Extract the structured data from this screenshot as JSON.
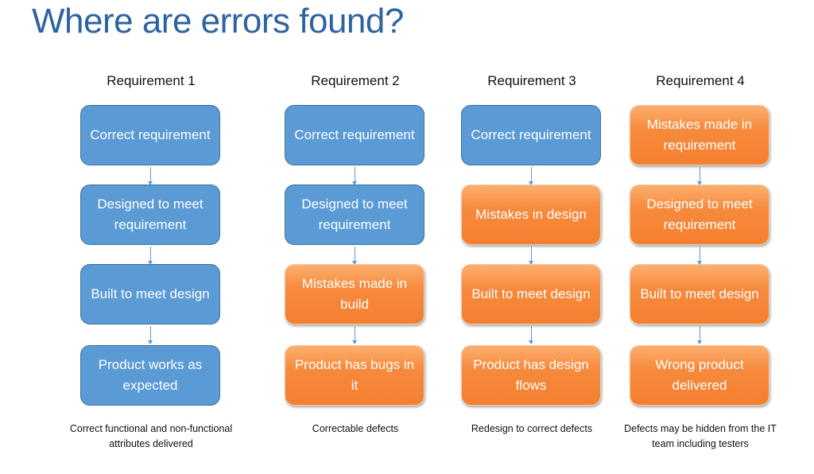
{
  "title": "Where are errors found?",
  "colors": {
    "correct": "#5b9bd5",
    "mistake": "#f68a3d",
    "title": "#2e63a2"
  },
  "columns": [
    {
      "heading": "Requirement 1",
      "steps": [
        {
          "text": "Correct requirement",
          "status": "correct"
        },
        {
          "text": "Designed to meet requirement",
          "status": "correct"
        },
        {
          "text": "Built to meet design",
          "status": "correct"
        },
        {
          "text": "Product works as expected",
          "status": "correct"
        }
      ],
      "note": "Correct functional and non-functional attributes delivered"
    },
    {
      "heading": "Requirement 2",
      "steps": [
        {
          "text": "Correct requirement",
          "status": "correct"
        },
        {
          "text": "Designed to meet requirement",
          "status": "correct"
        },
        {
          "text": "Mistakes made in build",
          "status": "mistake"
        },
        {
          "text": "Product has bugs in it",
          "status": "mistake"
        }
      ],
      "note": "Correctable defects"
    },
    {
      "heading": "Requirement 3",
      "steps": [
        {
          "text": "Correct requirement",
          "status": "correct"
        },
        {
          "text": "Mistakes in design",
          "status": "mistake"
        },
        {
          "text": "Built to meet design",
          "status": "mistake"
        },
        {
          "text": "Product has design flows",
          "status": "mistake"
        }
      ],
      "note": "Redesign to correct defects"
    },
    {
      "heading": "Requirement 4",
      "steps": [
        {
          "text": "Mistakes made in requirement",
          "status": "mistake"
        },
        {
          "text": "Designed to meet requirement",
          "status": "mistake"
        },
        {
          "text": "Built to meet design",
          "status": "mistake"
        },
        {
          "text": "Wrong product delivered",
          "status": "mistake"
        }
      ],
      "note": "Defects may be hidden from the IT team including testers"
    }
  ]
}
